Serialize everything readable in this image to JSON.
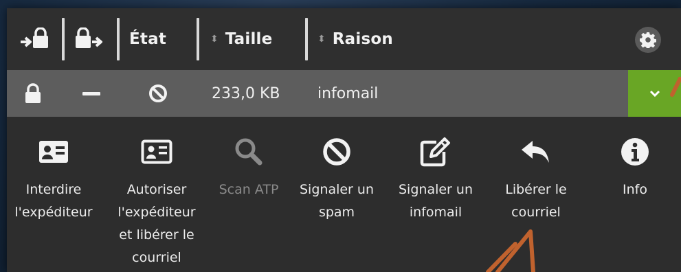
{
  "header": {
    "columns": [
      {
        "id": "lock-col",
        "icon": "lock-in-icon"
      },
      {
        "id": "unlock-col",
        "icon": "lock-out-icon"
      },
      {
        "id": "etat",
        "label": "État"
      },
      {
        "id": "taille",
        "label": "Taille",
        "sortable": true
      },
      {
        "id": "raison",
        "label": "Raison",
        "sortable": true
      }
    ],
    "settings_icon": "gear-icon"
  },
  "row": {
    "lock_icon": "lock-icon",
    "dash_icon": "minus-icon",
    "state_icon": "block-icon",
    "size": "233,0 KB",
    "reason": "infomail",
    "expand_icon": "chevron-down-icon",
    "expand_color": "#69a625"
  },
  "actions": [
    {
      "id": "ban-sender",
      "icon": "contact-card-icon",
      "label": "Interdire\nl'expéditeur",
      "enabled": true
    },
    {
      "id": "allow-release",
      "icon": "contact-card-outline-icon",
      "label": "Autoriser\nl'expéditeur\net libérer le\ncourriel",
      "enabled": true
    },
    {
      "id": "scan-atp",
      "icon": "search-icon",
      "label": "Scan ATP",
      "enabled": false
    },
    {
      "id": "report-spam",
      "icon": "block-icon",
      "label": "Signaler un\nspam",
      "enabled": true
    },
    {
      "id": "report-infomail",
      "icon": "edit-icon",
      "label": "Signaler un\ninfomail",
      "enabled": true
    },
    {
      "id": "release",
      "icon": "reply-icon",
      "label": "Libérer le\ncourriel",
      "enabled": true
    },
    {
      "id": "info",
      "icon": "info-icon",
      "label": "Info",
      "enabled": true
    }
  ],
  "annotation_color": "#c0622e"
}
